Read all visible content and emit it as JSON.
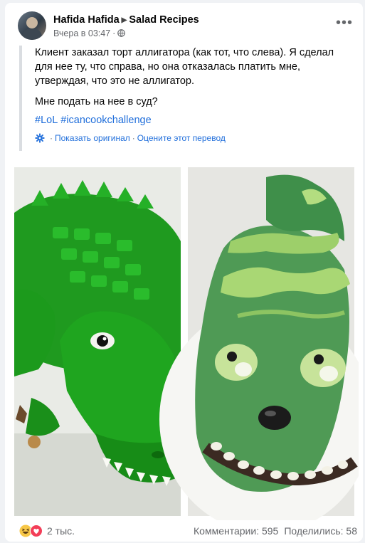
{
  "post": {
    "author": "Hafida Hafida",
    "group": "Salad Recipes",
    "time": "Вчера в 03:47",
    "text": "Клиент заказал торт аллигатора (как тот, что слева). Я сделал для нее ту, что справа, но она отказалась платить мне, утверждая, что это не аллигатор.",
    "question": "Мне подать на нее в суд?",
    "hashtags": [
      "#LoL",
      "#icancookchallenge"
    ],
    "show_original": "Показать оригинал",
    "rate_translation": "Оцените этот перевод"
  },
  "footer": {
    "reaction_count": "2 тыс.",
    "comments": "Комментарии: 595",
    "shares": "Поделились: 58"
  },
  "icons": {
    "more": "more-options-icon",
    "privacy": "globe-icon",
    "translate": "gear-icon",
    "reactions": [
      "haha-icon",
      "love-icon"
    ]
  },
  "colors": {
    "link": "#216fdb",
    "secondary_text": "#65676b",
    "quote_bar": "#dadde1"
  }
}
